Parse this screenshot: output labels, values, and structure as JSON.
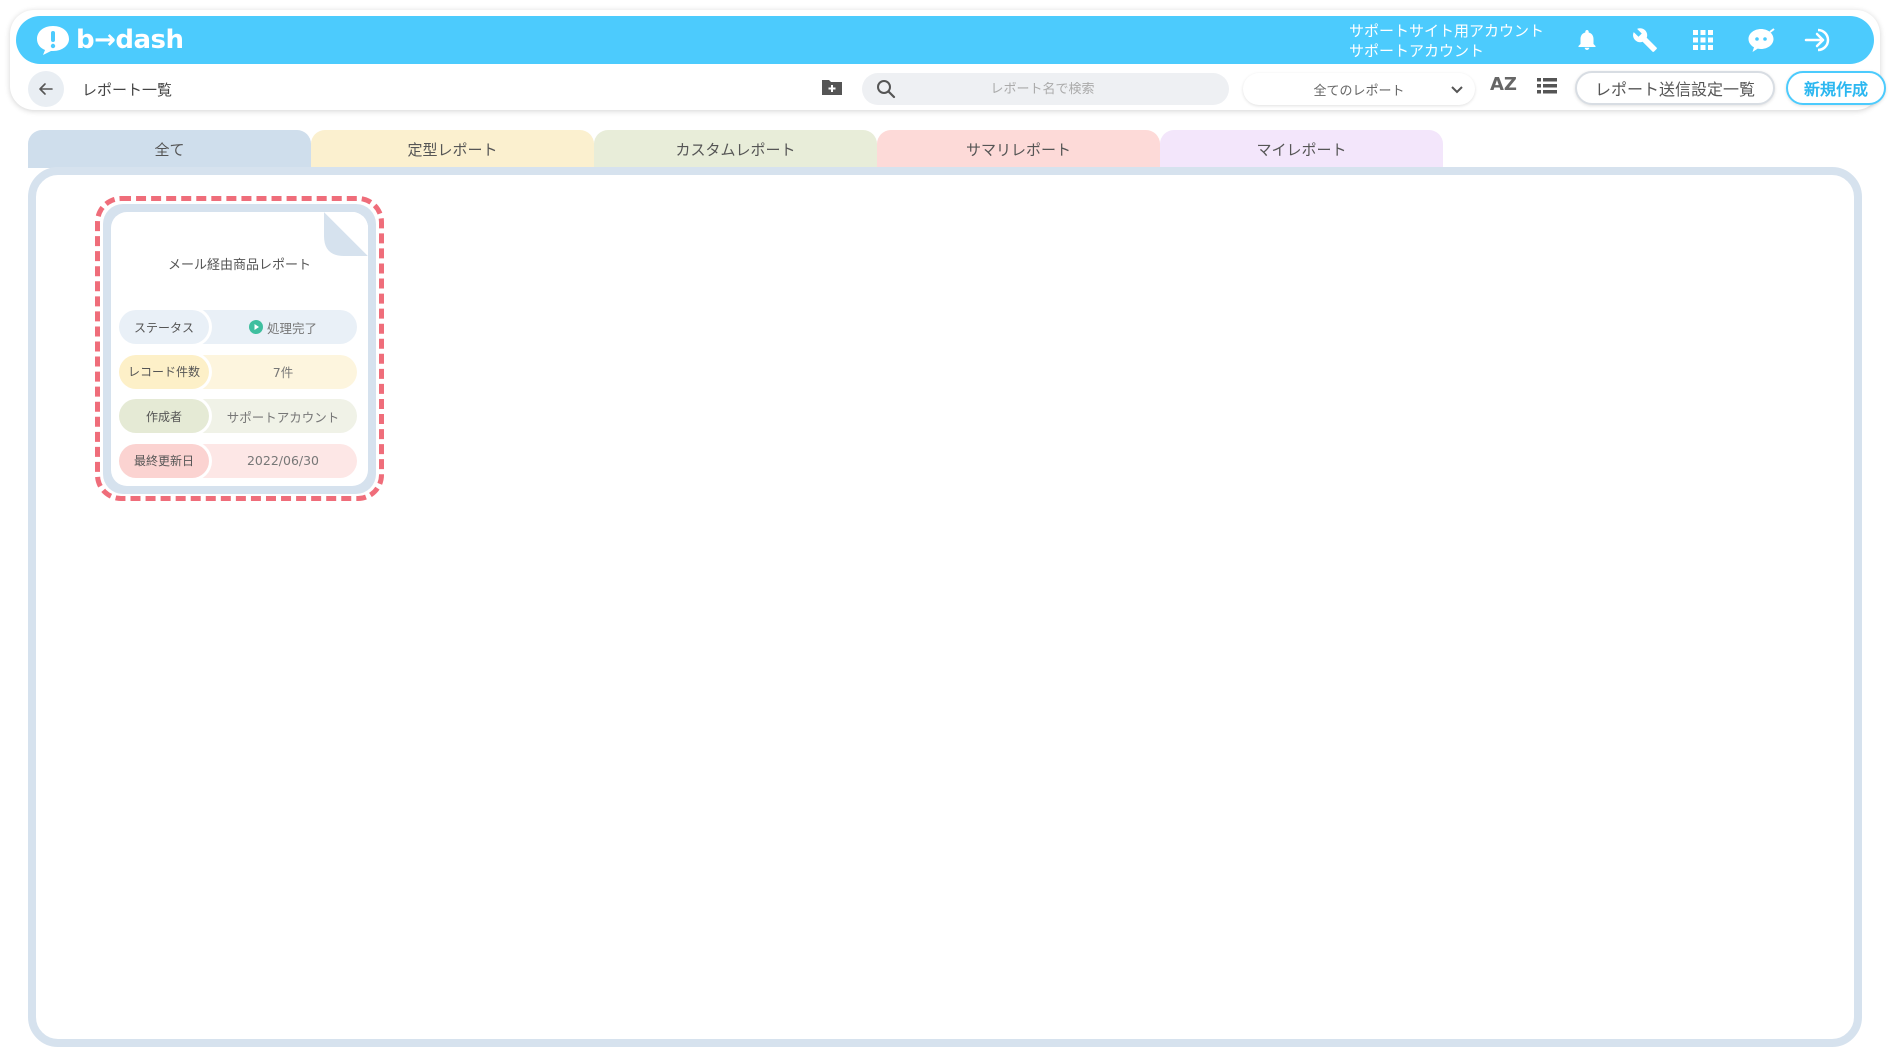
{
  "app": {
    "brand": "b→dash",
    "account_line1": "サポートサイト用アカウント",
    "account_line2": "サポートアカウント"
  },
  "topbar_icons": [
    "bell-icon",
    "wrench-icon",
    "apps-grid-icon",
    "chat-bot-icon",
    "logout-icon"
  ],
  "toolbar": {
    "page_title": "レポート一覧",
    "search_placeholder": "レポート名で検索",
    "filter_selected": "全てのレポート",
    "sort_label": "AZ",
    "send_settings_label": "レポート送信設定一覧",
    "new_label": "新規作成"
  },
  "tabs": [
    {
      "label": "全て",
      "color": "#cfdeec"
    },
    {
      "label": "定型レポート",
      "color": "#fbf0cf"
    },
    {
      "label": "カスタムレポート",
      "color": "#e8edd9"
    },
    {
      "label": "サマリレポート",
      "color": "#fddad8"
    },
    {
      "label": "マイレポート",
      "color": "#f3e6fb"
    }
  ],
  "report_card": {
    "title": "メール経由商品レポート",
    "rows": [
      {
        "label": "ステータス",
        "value": "処理完了",
        "color": "#e9f0f7"
      },
      {
        "label": "レコード件数",
        "value": "7件",
        "color": "#fdf5de"
      },
      {
        "label": "作成者",
        "value": "サポートアカウント",
        "color": "#f0f2e7"
      },
      {
        "label": "最終更新日",
        "value": "2022/06/30",
        "color": "#fde7e6"
      }
    ]
  },
  "colors": {
    "accent": "#4ccbfd",
    "highlight_border": "#ef6d7a",
    "status_ok": "#3fbf9f"
  }
}
